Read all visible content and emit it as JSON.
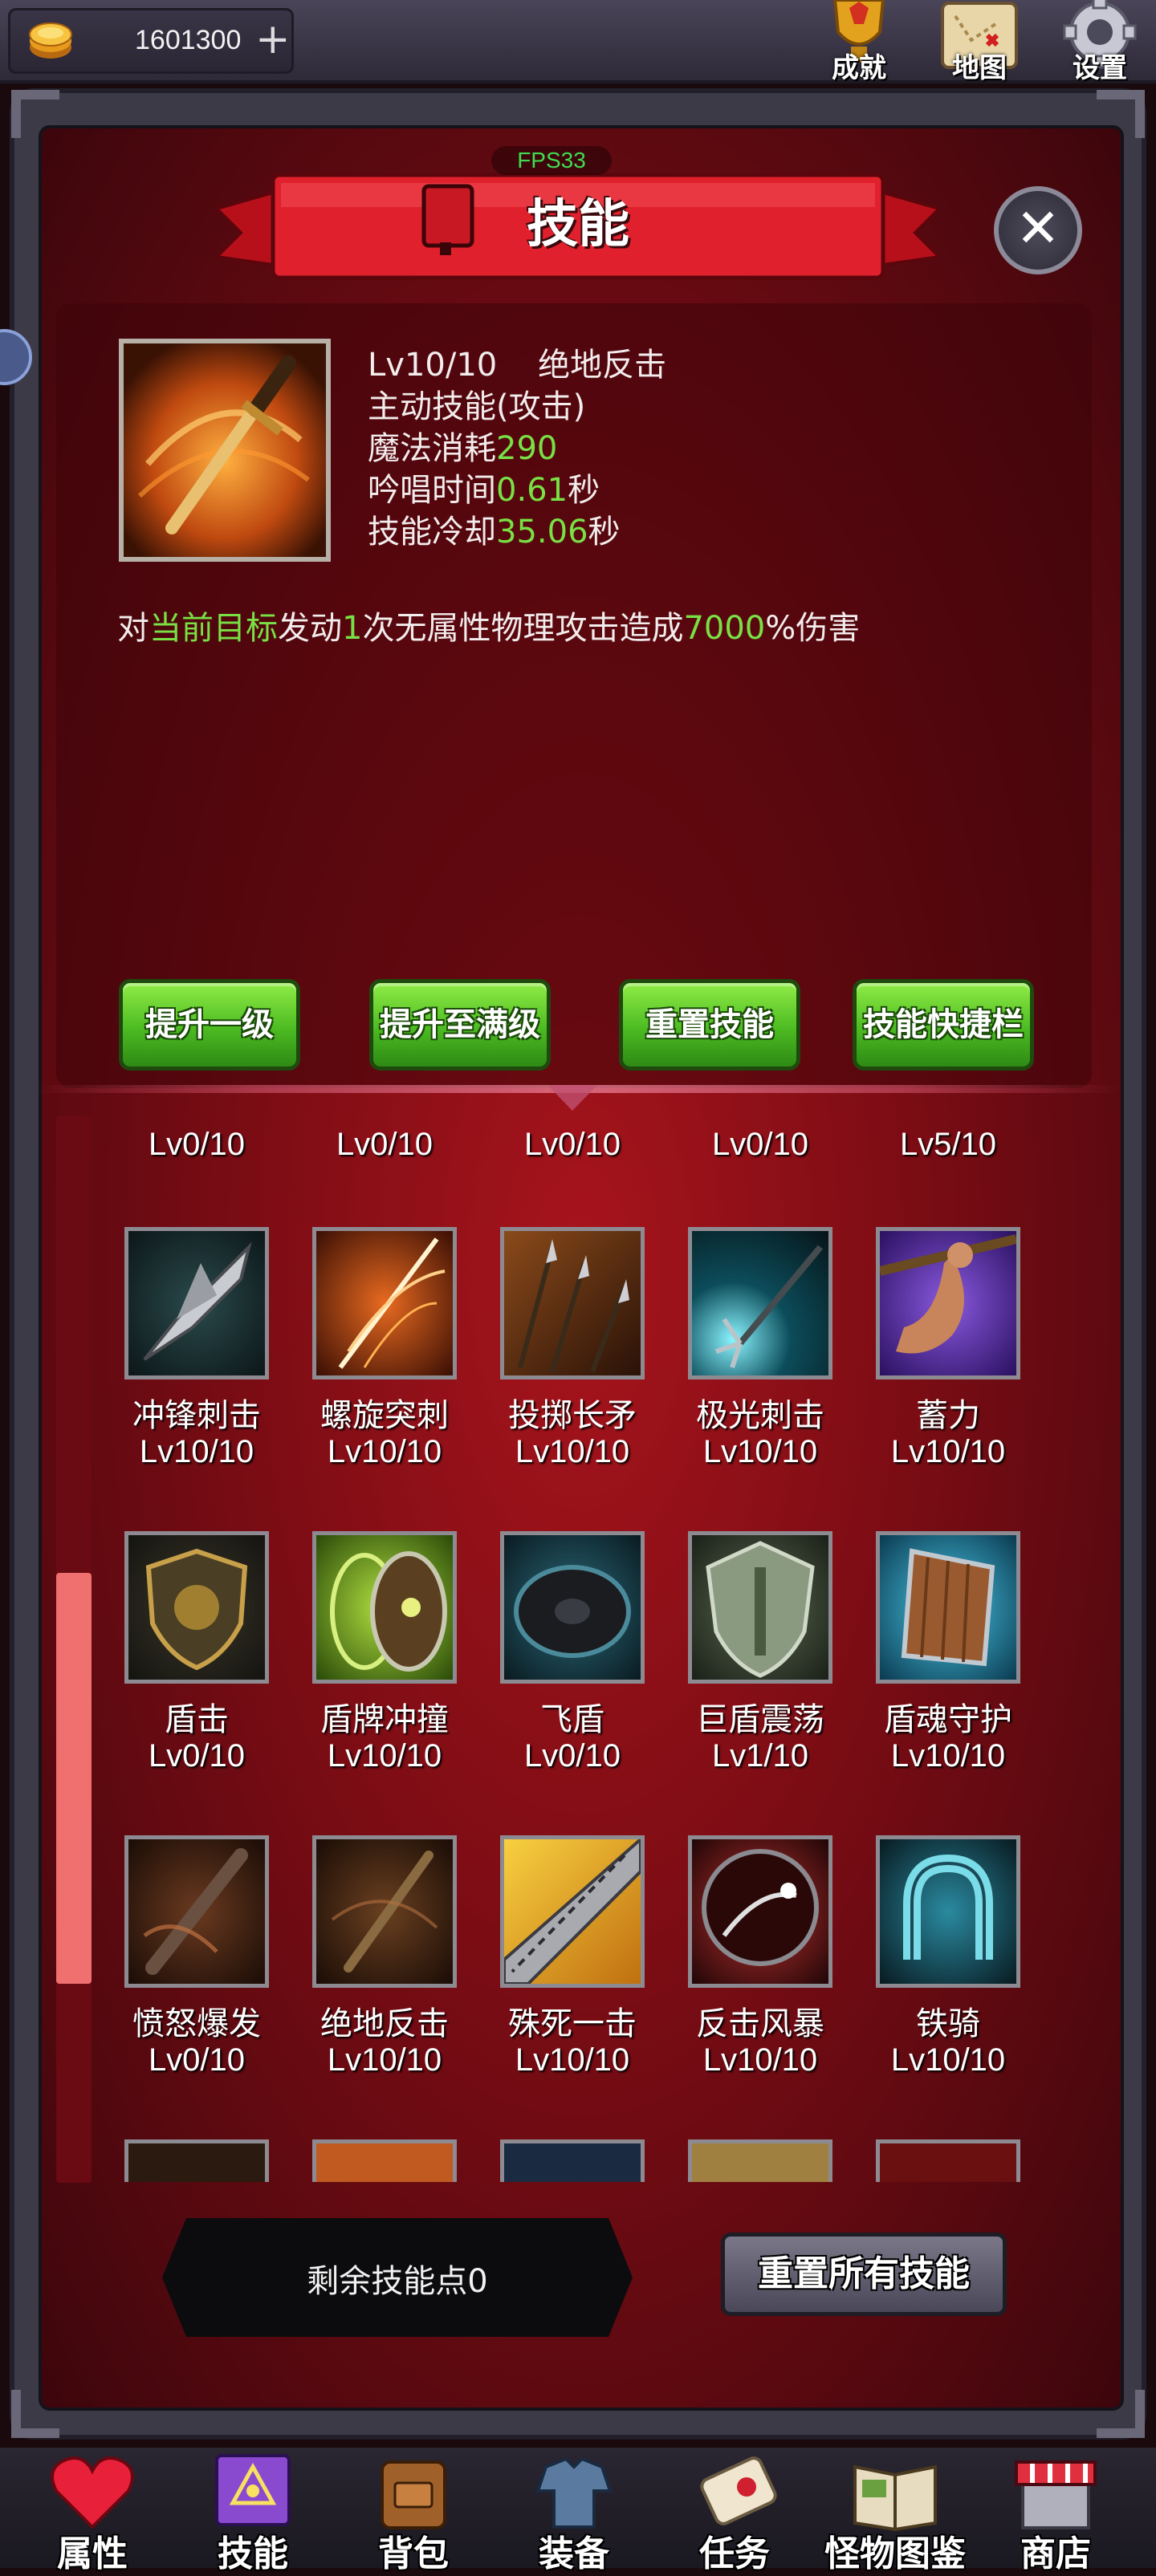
{
  "topbar": {
    "coins": "1601300",
    "plus_icon": "+",
    "icons": [
      {
        "name": "achievement-icon",
        "label": "成就"
      },
      {
        "name": "map-icon",
        "label": "地图"
      },
      {
        "name": "settings-icon",
        "label": "设置"
      }
    ]
  },
  "header": {
    "fps": "FPS33",
    "title": "技能",
    "close_icon": "✕"
  },
  "selected_skill": {
    "level": "Lv10/10",
    "name": "绝地反击",
    "type": "主动技能(攻击)",
    "mana_label": "魔法消耗",
    "mana_value": "290",
    "cast_label": "吟唱时间",
    "cast_value": "0.61",
    "cast_unit": "秒",
    "cooldown_label": "技能冷却",
    "cooldown_value": "35.06",
    "cooldown_unit": "秒",
    "desc": {
      "p1": "对",
      "target": "当前目标",
      "p2": "发动",
      "count": "1",
      "p3": "次无属性物理攻击造成",
      "percent": "7000",
      "p4": "%伤害"
    }
  },
  "actions": {
    "upgrade_one": "提升一级",
    "upgrade_max": "提升至满级",
    "reset_skill": "重置技能",
    "shortcut_bar": "技能快捷栏"
  },
  "skill_grid": {
    "partial_row_levels": [
      "Lv0/10",
      "Lv0/10",
      "Lv0/10",
      "Lv0/10",
      "Lv5/10"
    ],
    "rows": [
      [
        {
          "name": "冲锋刺击",
          "level": "Lv10/10",
          "icon": "spear-tip-icon"
        },
        {
          "name": "螺旋突刺",
          "level": "Lv10/10",
          "icon": "spiral-thrust-icon"
        },
        {
          "name": "投掷长矛",
          "level": "Lv10/10",
          "icon": "throwing-spears-icon"
        },
        {
          "name": "极光刺击",
          "level": "Lv10/10",
          "icon": "trident-icon"
        },
        {
          "name": "蓄力",
          "level": "Lv10/10",
          "icon": "charge-arm-icon"
        }
      ],
      [
        {
          "name": "盾击",
          "level": "Lv0/10",
          "icon": "lion-shield-icon"
        },
        {
          "name": "盾牌冲撞",
          "level": "Lv10/10",
          "icon": "shield-bash-icon"
        },
        {
          "name": "飞盾",
          "level": "Lv0/10",
          "icon": "flying-shield-icon"
        },
        {
          "name": "巨盾震荡",
          "level": "Lv1/10",
          "icon": "giant-shield-icon"
        },
        {
          "name": "盾魂守护",
          "level": "Lv10/10",
          "icon": "wooden-shield-icon"
        }
      ],
      [
        {
          "name": "愤怒爆发",
          "level": "Lv0/10",
          "icon": "rage-sword-icon"
        },
        {
          "name": "绝地反击",
          "level": "Lv10/10",
          "icon": "counter-sword-icon"
        },
        {
          "name": "殊死一击",
          "level": "Lv10/10",
          "icon": "golden-blade-icon"
        },
        {
          "name": "反击风暴",
          "level": "Lv10/10",
          "icon": "counter-storm-icon"
        },
        {
          "name": "铁骑",
          "level": "Lv10/10",
          "icon": "horseshoe-icon"
        }
      ]
    ]
  },
  "footer": {
    "points": "剩余技能点0",
    "reset_all": "重置所有技能"
  },
  "bottom_nav": [
    {
      "label": "属性",
      "icon": "heart-icon"
    },
    {
      "label": "技能",
      "icon": "spellbook-icon"
    },
    {
      "label": "背包",
      "icon": "backpack-icon"
    },
    {
      "label": "装备",
      "icon": "armor-icon"
    },
    {
      "label": "任务",
      "icon": "quest-scroll-icon"
    },
    {
      "label": "怪物图鉴",
      "icon": "bestiary-book-icon"
    },
    {
      "label": "商店",
      "icon": "shop-icon"
    }
  ],
  "colors": {
    "highlight_green": "#79e045",
    "panel_red": "#a8141c",
    "button_green": "#4cbb22",
    "scroll_thumb": "#f07070"
  }
}
